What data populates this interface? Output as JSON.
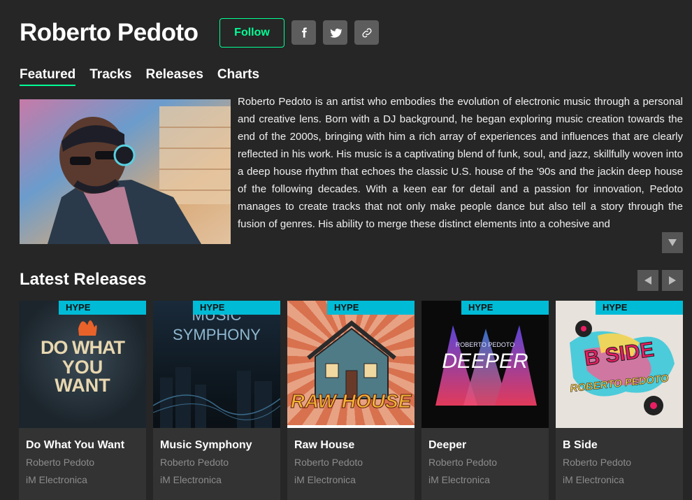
{
  "artist": {
    "name": "Roberto Pedoto",
    "follow_label": "Follow",
    "bio": "Roberto Pedoto is an artist who embodies the evolution of electronic music through a personal and creative lens. Born with a DJ background, he began exploring music creation towards the end of the 2000s, bringing with him a rich array of experiences and influences that are clearly reflected in his work. His music is a captivating blend of funk, soul, and jazz, skillfully woven into a deep house rhythm that echoes the classic U.S. house of the '90s and the jackin deep house of the following decades. With a keen ear for detail and a passion for innovation, Pedoto manages to create tracks that not only make people dance but also tell a story through the fusion of genres. His ability to merge these distinct elements into a cohesive and"
  },
  "share_icons": [
    "facebook-icon",
    "twitter-icon",
    "link-icon"
  ],
  "tabs": [
    {
      "label": "Featured",
      "active": true
    },
    {
      "label": "Tracks",
      "active": false
    },
    {
      "label": "Releases",
      "active": false
    },
    {
      "label": "Charts",
      "active": false
    }
  ],
  "latest_releases": {
    "title": "Latest Releases",
    "items": [
      {
        "badge": "HYPE",
        "title": "Do What You Want",
        "artist": "Roberto Pedoto",
        "label": "iM Electronica",
        "art_text": [
          "DO WHAT",
          "YOU",
          "WANT"
        ]
      },
      {
        "badge": "HYPE",
        "title": "Music Symphony",
        "artist": "Roberto Pedoto",
        "label": "iM Electronica",
        "art_text": [
          "MUSIC",
          "SYMPHONY"
        ]
      },
      {
        "badge": "HYPE",
        "title": "Raw House",
        "artist": "Roberto Pedoto",
        "label": "iM Electronica",
        "art_text": [
          "RAW HOUSE"
        ]
      },
      {
        "badge": "HYPE",
        "title": "Deeper",
        "artist": "Roberto Pedoto",
        "label": "iM Electronica",
        "art_text": [
          "ROBERTO PEDOTO",
          "DEEPER"
        ]
      },
      {
        "badge": "HYPE",
        "title": "B Side",
        "artist": "Roberto Pedoto",
        "label": "iM Electronica",
        "art_text": [
          "B SIDE",
          "ROBERTO PEDOTO"
        ]
      }
    ]
  },
  "colors": {
    "accent": "#01ff95",
    "badge": "#00bbd6",
    "background": "#262626",
    "card": "#333333"
  }
}
